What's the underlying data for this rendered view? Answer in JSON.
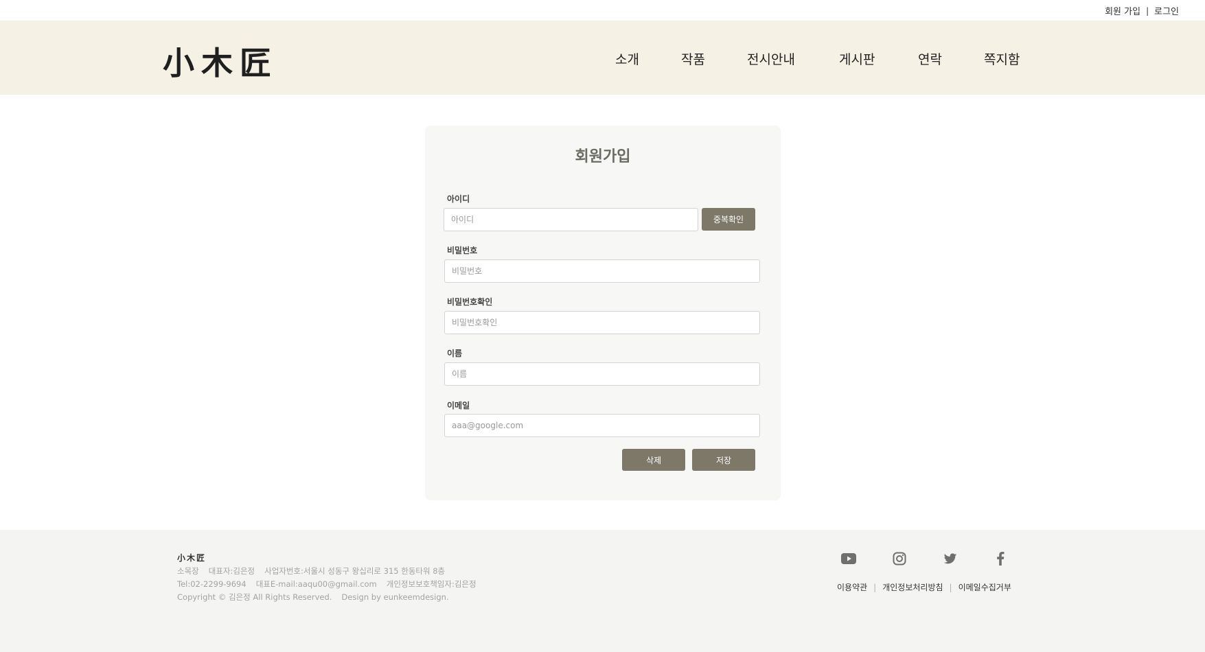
{
  "topbar": {
    "signup": "회원 가입",
    "separator": "|",
    "login": "로그인"
  },
  "header": {
    "logo": "小木匠",
    "nav": [
      "소개",
      "작품",
      "전시안내",
      "게시판",
      "연락",
      "쪽지함"
    ]
  },
  "form": {
    "title": "회원가입",
    "fields": [
      {
        "label": "아이디",
        "placeholder": "아이디",
        "value": ""
      },
      {
        "label": "비밀번호",
        "placeholder": "비밀번호",
        "value": ""
      },
      {
        "label": "비밀번호확인",
        "placeholder": "비밀번호확인",
        "value": ""
      },
      {
        "label": "이름",
        "placeholder": "이름",
        "value": ""
      },
      {
        "label": "이메일",
        "placeholder": "aaa@google.com",
        "value": ""
      }
    ],
    "check_button": "중복확인",
    "delete_button": "삭제",
    "save_button": "저장"
  },
  "footer": {
    "logo": "小木匠",
    "line1": [
      "소목장",
      "대표자:김은정",
      "사업자번호:서울시 성동구 왕십리로 315 한동타워 8층"
    ],
    "line2": [
      "Tel:02-2299-9694",
      "대표E-mail:aaqu00@gmail.com",
      "개인정보보호책임자:김은정"
    ],
    "line3": [
      "Copyright © 김은정  All Rights Reserved.",
      "Design by eunkeemdesign."
    ],
    "social_icons": [
      "youtube-icon",
      "instagram-icon",
      "twitter-icon",
      "facebook-icon"
    ],
    "links": [
      "이용약관",
      "개인정보처리방침",
      "이메일수집거부"
    ],
    "link_separator": "|"
  },
  "colors": {
    "header_bg": "#f6f1e5",
    "button": "#7d7868",
    "card_bg": "#f7f7f5",
    "footer_bg": "#f4f4f2"
  }
}
